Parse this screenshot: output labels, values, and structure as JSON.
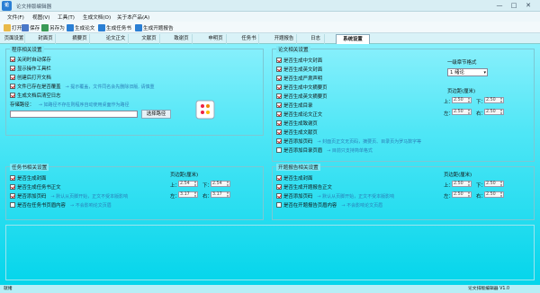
{
  "window": {
    "title": "论文排版编辑器",
    "minimize": "—",
    "maximize": "□",
    "close": "✕"
  },
  "menu": [
    "文件(F)",
    "视图(V)",
    "工具(T)",
    "生成文档(O)",
    "关于本产品(A)"
  ],
  "toolbar": {
    "open": "打开",
    "save": "保存",
    "save_as": "另存为",
    "gen_paper": "生成论文",
    "gen_task": "生成任务书",
    "gen_report": "生成开题报告"
  },
  "tabs": [
    "页面设置",
    "封面页",
    "摘要页",
    "论文正文",
    "文献页",
    "致谢页",
    "申明页",
    "任务书",
    "开题报告",
    "日志",
    "系统设置"
  ],
  "active_tab_index": 10,
  "left_top": {
    "title": "程序相关设置",
    "options": [
      {
        "label": "关闭时自动保存",
        "checked": true
      },
      {
        "label": "显示操作工具栏",
        "checked": true
      },
      {
        "label": "创建后打开文档",
        "checked": true
      },
      {
        "label": "文件已存在是否覆盖",
        "checked": true,
        "hint": "→ 提示覆盖，文件同名会先删除旧版, 请慎重"
      },
      {
        "label": "生成文档后清空日志",
        "checked": true
      }
    ],
    "path_label": "存储路径：",
    "path_hint": "→ 如路径不存在则程序自动使用桌面作为路径",
    "path_value": "",
    "select_path_button": "选择路径"
  },
  "right_top": {
    "title": "论文相关设置",
    "options": [
      {
        "label": "是否生成中文封面",
        "checked": true
      },
      {
        "label": "是否生成英文封面",
        "checked": true
      },
      {
        "label": "是否生成严肃声明",
        "checked": true
      },
      {
        "label": "是否生成中文摘要页",
        "checked": true
      },
      {
        "label": "是否生成英文摘要页",
        "checked": true
      },
      {
        "label": "是否生成目录",
        "checked": true
      },
      {
        "label": "是否生成论文正文",
        "checked": true
      },
      {
        "label": "是否生成致谢页",
        "checked": true
      },
      {
        "label": "是否生成文献页",
        "checked": true
      },
      {
        "label": "是否添加页码",
        "checked": true,
        "hint": "→ 封面页正文无页码，摘要页、目录页为罗马数字等"
      },
      {
        "label": "是否添加目录页眉",
        "checked": false,
        "hint": "→ 目前只支持简单格式"
      }
    ],
    "chapter_label": "一级章节格式",
    "chapter_number": "1",
    "chapter_value": "绪论",
    "margin_label": "页边距(厘米)",
    "margin": {
      "top_label": "上：",
      "top": "2.50",
      "bottom_label": "下：",
      "bottom": "2.50",
      "left_label": "左：",
      "left": "2.50",
      "right_label": "右：",
      "right": "2.50"
    }
  },
  "left_bottom": {
    "title": "任务书相关设置",
    "options": [
      {
        "label": "是否生成封面",
        "checked": true
      },
      {
        "label": "是否生成任务书正文",
        "checked": true
      },
      {
        "label": "是否添加页码",
        "checked": true,
        "hint": "→ 默认从页脚开始，正文不受本版影响"
      },
      {
        "label": "是否在任务书页眉内容",
        "checked": false,
        "hint": "→ 不会影响论文页眉"
      }
    ],
    "margin_label": "页边距(厘米)",
    "margin": {
      "top_label": "上：",
      "top": "2.54",
      "bottom_label": "下：",
      "bottom": "2.54",
      "left_label": "左：",
      "left": "3.17",
      "right_label": "右：",
      "right": "3.17"
    }
  },
  "right_bottom": {
    "title": "开题报告相关设置",
    "options": [
      {
        "label": "是否生成封面",
        "checked": true
      },
      {
        "label": "是否生成开题报告正文",
        "checked": true
      },
      {
        "label": "是否添加页码",
        "checked": true,
        "hint": "→ 默认从页脚开始，正文不受本版影响"
      },
      {
        "label": "是否在开题报告页眉内容",
        "checked": false,
        "hint": "→ 不会影响论文页眉"
      }
    ],
    "margin_label": "页边距(厘米)",
    "margin": {
      "top_label": "上：",
      "top": "2.50",
      "bottom_label": "下：",
      "bottom": "2.50",
      "left_label": "左：",
      "left": "2.50",
      "right_label": "右：",
      "right": "2.50"
    }
  },
  "status": {
    "left": "就绪",
    "right": "论文排版编辑器 V1.0"
  },
  "colors": {
    "accent": "#2a7fd4",
    "check": "#cc2222",
    "hint": "#2b7fb8"
  }
}
